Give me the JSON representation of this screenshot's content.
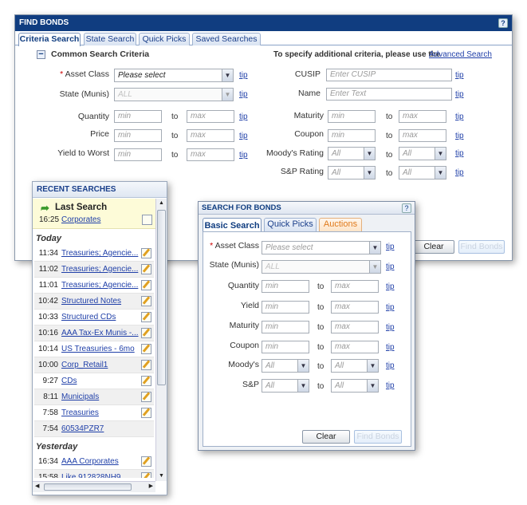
{
  "find_bonds": {
    "title": "FIND BONDS",
    "help": "?",
    "tabs": [
      "Criteria Search",
      "State Search",
      "Quick Picks",
      "Saved Searches"
    ],
    "section_title": "Common Search Criteria",
    "collapse": "−",
    "advanced_prefix": "To specify additional criteria, please use the",
    "advanced_link": "Advanced Search",
    "fields": {
      "asset_class": "Asset Class",
      "asset_class_value": "Please select",
      "state": "State (Munis)",
      "state_value": "ALL",
      "quantity": "Quantity",
      "price": "Price",
      "yield": "Yield to Worst",
      "cusip": "CUSIP",
      "cusip_placeholder": "Enter CUSIP",
      "name": "Name",
      "name_placeholder": "Enter Text",
      "maturity": "Maturity",
      "coupon": "Coupon",
      "moodys": "Moody's Rating",
      "sp": "S&P Rating"
    },
    "min": "min",
    "max": "max",
    "all": "All",
    "to": "to",
    "tip": "tip",
    "clear": "Clear",
    "find": "Find Bonds"
  },
  "recent": {
    "title": "RECENT SEARCHES",
    "last_label": "Last Search",
    "last": {
      "time": "16:25",
      "name": "Corporates"
    },
    "today_label": "Today",
    "today": [
      {
        "time": "11:34",
        "name": "Treasuries; Agencie..."
      },
      {
        "time": "11:02",
        "name": "Treasuries; Agencie..."
      },
      {
        "time": "11:01",
        "name": "Treasuries; Agencie..."
      },
      {
        "time": "10:42",
        "name": "Structured Notes"
      },
      {
        "time": "10:33",
        "name": "Structured CDs"
      },
      {
        "time": "10:16",
        "name": "AAA Tax-Ex Munis -..."
      },
      {
        "time": "10:14",
        "name": "US Treasuries - 6mo"
      },
      {
        "time": "10:00",
        "name": "Corp_Retail1"
      },
      {
        "time": "9:27",
        "name": "CDs"
      },
      {
        "time": "8:11",
        "name": "Municipals"
      },
      {
        "time": "7:58",
        "name": "Treasuries"
      },
      {
        "time": "7:54",
        "name": "60534PZR7"
      }
    ],
    "yesterday_label": "Yesterday",
    "yesterday": [
      {
        "time": "16:34",
        "name": "AAA Corporates"
      },
      {
        "time": "15:58",
        "name": "Like 912828NH9"
      }
    ]
  },
  "search_for_bonds": {
    "title": "SEARCH FOR BONDS",
    "help": "?",
    "tabs": [
      "Basic Search",
      "Quick Picks",
      "Auctions"
    ],
    "fields": {
      "asset_class": "Asset Class",
      "asset_class_value": "Please select",
      "state": "State (Munis)",
      "state_value": "ALL",
      "quantity": "Quantity",
      "yield": "Yield",
      "maturity": "Maturity",
      "coupon": "Coupon",
      "moodys": "Moody's",
      "sp": "S&P"
    },
    "min": "min",
    "max": "max",
    "all": "All",
    "to": "to",
    "tip": "tip",
    "clear": "Clear",
    "find": "Find Bonds"
  }
}
